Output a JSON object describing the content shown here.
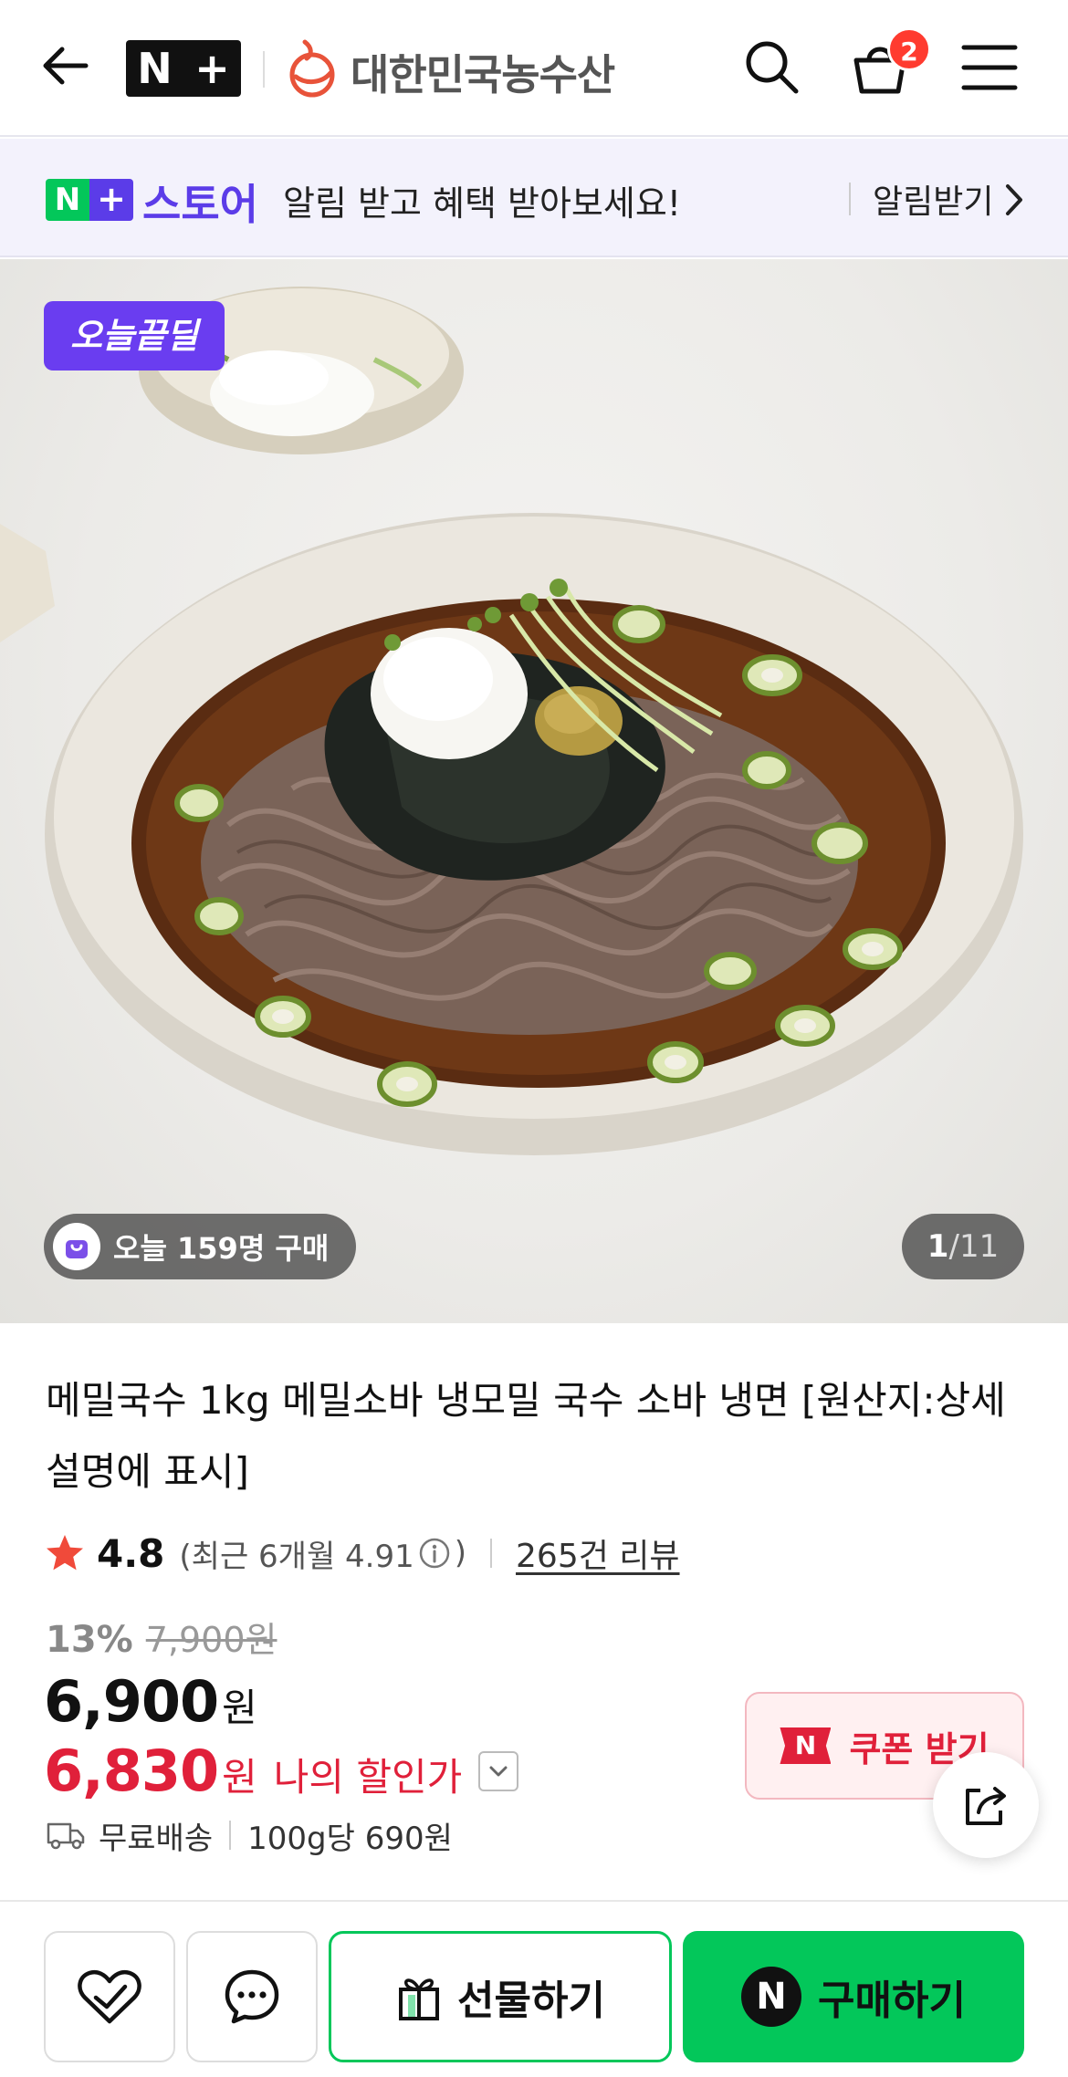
{
  "header": {
    "np_logo_n": "N",
    "np_logo_plus": "+",
    "brand_name": "대한민국농수산",
    "cart_count": "2"
  },
  "store_banner": {
    "logo_n": "N",
    "logo_plus": "+",
    "store_name": "스토어",
    "message": "알림 받고 혜택 받아보세요!",
    "alarm_label": "알림받기"
  },
  "product_image": {
    "deal_badge": "오늘끝딜",
    "buyers_text": "오늘 159명 구매",
    "counter_current": "1",
    "counter_sep": "/",
    "counter_total": "11"
  },
  "product": {
    "title": "메밀국수 1kg 메밀소바 냉모밀 국수 소바 냉면 [원산지:상세설명에 표시]",
    "rating": "4.8",
    "rating_recent_prefix": "(최근 6개월 4.91",
    "rating_recent_suffix": ")",
    "review_link": "265건 리뷰",
    "discount_rate": "13%",
    "original_price": "7,900원",
    "price": "6,900",
    "price_unit": "원",
    "my_price": "6,830",
    "my_price_unit": "원",
    "my_price_label": "나의 할인가",
    "coupon_n": "N",
    "coupon_label": "쿠폰 받기",
    "delivery": "무료배송",
    "unit_price": "100g당 690원"
  },
  "bottom_bar": {
    "gift_label": "선물하기",
    "buy_n": "N",
    "buy_label": "구매하기"
  },
  "colors": {
    "naver_green": "#03c75a",
    "store_purple": "#5b3ce8",
    "sale_red": "#e0203a",
    "badge_red": "#ff3b2f"
  },
  "icons": [
    "back-arrow-icon",
    "search-icon",
    "cart-icon",
    "hamburger-menu-icon",
    "chevron-right-icon",
    "shopping-bag-icon",
    "star-icon",
    "info-icon",
    "chevron-down-icon",
    "share-icon",
    "truck-icon",
    "heart-check-icon",
    "chat-icon",
    "gift-icon"
  ]
}
